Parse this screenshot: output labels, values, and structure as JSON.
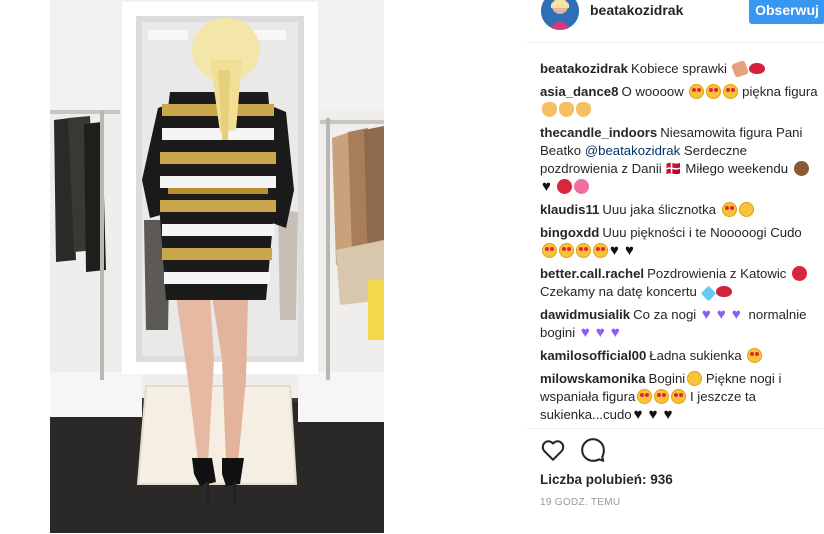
{
  "post": {
    "username": "beatakozidrak",
    "follow_label": "Obserwuj"
  },
  "comments": [
    {
      "user": "beatakozidrak",
      "text": "Kobiece sprawki",
      "emojis": [
        "nail-polish",
        "lips"
      ]
    },
    {
      "user": "asia_dance8",
      "text_before": "O woooow",
      "emojis_mid": [
        "heart-eyes",
        "heart-eyes",
        "heart-eyes"
      ],
      "text_after": "piękna figura",
      "emojis": [
        "ok-hand",
        "ok-hand",
        "ok-hand"
      ]
    },
    {
      "user": "thecandle_indoors",
      "text_before": "Niesamowita figura Pani Beatko",
      "mention": "@beatakozidrak",
      "text_after": "Serdeczne pozdrowienia z Danii 🇩🇰 Miłego weekendu",
      "emojis": [
        "see-no-evil-monkey",
        "black-heart",
        "rose",
        "tulip"
      ]
    },
    {
      "user": "klaudis11",
      "text": "Uuu jaka ślicznotka",
      "emojis": [
        "heart-eyes",
        "smile"
      ]
    },
    {
      "user": "bingoxdd",
      "text": "Uuu piękności i te Nooooogi Cudo",
      "emojis": [
        "heart-eyes",
        "heart-eyes",
        "heart-eyes",
        "heart-eyes",
        "black-heart",
        "black-heart"
      ]
    },
    {
      "user": "better.call.rachel",
      "text_before": "Pozdrowienia z Katowic",
      "emojis_mid": [
        "rose"
      ],
      "text_after": "Czekamy na datę koncertu",
      "emojis": [
        "gem",
        "lips"
      ]
    },
    {
      "user": "dawidmusialik",
      "text_before": "Co za nogi",
      "emojis_mid": [
        "purple-heart",
        "purple-heart",
        "purple-heart"
      ],
      "text_after": "normalnie bogini",
      "emojis": [
        "purple-heart",
        "purple-heart",
        "purple-heart"
      ]
    },
    {
      "user": "kamilosofficial00",
      "text": "Ładna sukienka",
      "emojis": [
        "heart-eyes"
      ]
    },
    {
      "user": "milowskamonika",
      "text_before": "Bogini",
      "emojis_mid": [
        "smile"
      ],
      "text_mid": "Piękne nogi i wspaniała figura",
      "emojis_mid2": [
        "heart-eyes",
        "heart-eyes",
        "heart-eyes"
      ],
      "text_after": "I jeszcze ta sukienka...cudo",
      "emojis": [
        "black-heart",
        "black-heart",
        "black-heart"
      ]
    }
  ],
  "actions": {
    "like_icon": "heart-outline-icon",
    "comment_icon": "comment-bubble-icon",
    "likes_label": "Liczba polubień: 936",
    "timestamp": "19 GODZ. TEMU"
  },
  "colors": {
    "follow_button": "#3897f0",
    "mention": "#003569",
    "timestamp": "#999999"
  }
}
